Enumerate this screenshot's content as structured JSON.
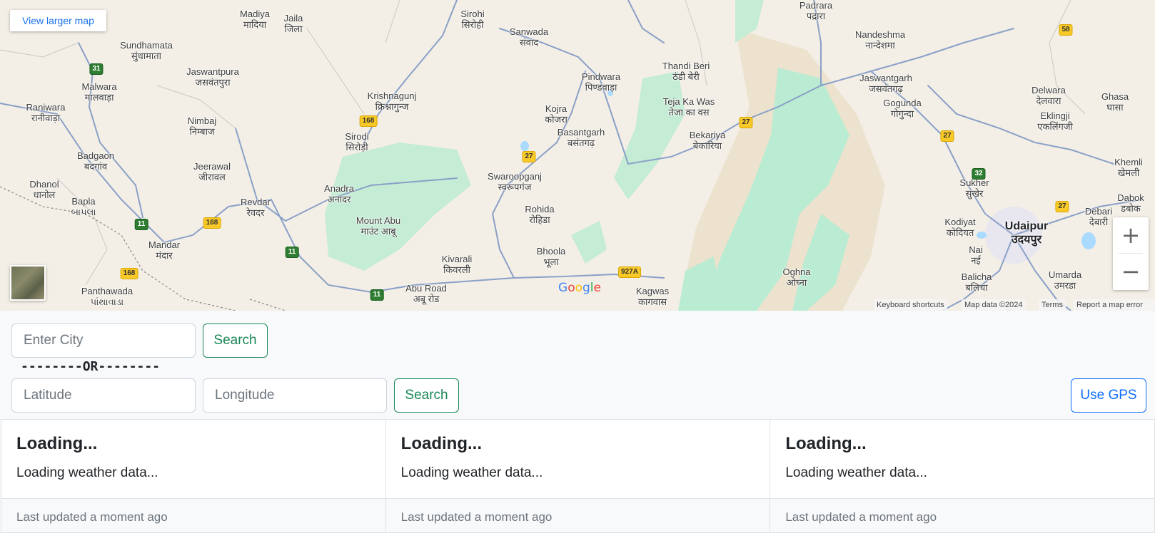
{
  "map": {
    "larger_map_label": "View larger map",
    "zoom_in": "+",
    "zoom_out": "−",
    "google_logo": [
      "G",
      "o",
      "o",
      "g",
      "l",
      "e"
    ],
    "google_colors": [
      "#4285F4",
      "#EA4335",
      "#FBBC05",
      "#4285F4",
      "#34A853",
      "#EA4335"
    ],
    "attribution": {
      "shortcuts": "Keyboard shortcuts",
      "map_data": "Map data ©2024",
      "terms": "Terms",
      "report": "Report a map error"
    },
    "places": [
      {
        "name": "Madiya",
        "local": "मादिया"
      },
      {
        "name": "Jaila",
        "local": "जिला"
      },
      {
        "name": "Sirohi",
        "local": "सिरोही"
      },
      {
        "name": "Sanwada",
        "local": "संवाद"
      },
      {
        "name": "Padrara",
        "local": "पद्रारा"
      },
      {
        "name": "Nandeshma",
        "local": "नान्देशमा"
      },
      {
        "name": "Sundhamata",
        "local": "सुंधामाता"
      },
      {
        "name": "Jaswantpura",
        "local": "जसवंतपुरा"
      },
      {
        "name": "Pindwara",
        "local": "पिण्डवाड़ा"
      },
      {
        "name": "Thandi Beri",
        "local": "ठंडी बेरी"
      },
      {
        "name": "Jaswantgarh",
        "local": "जसवंतगढ़"
      },
      {
        "name": "Malwara",
        "local": "मालवाड़ा"
      },
      {
        "name": "Krishnagunj",
        "local": "क्रिश्नागुन्ज"
      },
      {
        "name": "Teja Ka Was",
        "local": "तेजा का वस"
      },
      {
        "name": "Gogunda",
        "local": "गोगुन्दा"
      },
      {
        "name": "Delwara",
        "local": "देलवारा"
      },
      {
        "name": "Ghasa",
        "local": "घासा"
      },
      {
        "name": "Raniwara",
        "local": "रानीवाड़ा"
      },
      {
        "name": "Kojra",
        "local": "कोजरा"
      },
      {
        "name": "Eklingji",
        "local": "एकलिंगजी"
      },
      {
        "name": "Nimbaj",
        "local": "निम्बाज"
      },
      {
        "name": "Basantgarh",
        "local": "बसंतगढ़"
      },
      {
        "name": "Sirodi",
        "local": "सिरोड़ी"
      },
      {
        "name": "Bekariya",
        "local": "बेकारिया"
      },
      {
        "name": "Badgaon",
        "local": "बदगांव"
      },
      {
        "name": "Jeerawal",
        "local": "जीरावल"
      },
      {
        "name": "Khemli",
        "local": "खेमली"
      },
      {
        "name": "Swaroopganj",
        "local": "स्वरूपगंज"
      },
      {
        "name": "Dhanol",
        "local": "धानोल"
      },
      {
        "name": "Anadra",
        "local": "अनादर"
      },
      {
        "name": "Sukher",
        "local": "सुखेर"
      },
      {
        "name": "Dabok",
        "local": "डबोक"
      },
      {
        "name": "Bapla",
        "local": "બાપલા"
      },
      {
        "name": "Revdar",
        "local": "रेवदर"
      },
      {
        "name": "Rohida",
        "local": "रोहिडा"
      },
      {
        "name": "Debari",
        "local": "देबारी"
      },
      {
        "name": "Mount Abu",
        "local": "माउंट आबू"
      },
      {
        "name": "Kodiyat",
        "local": "कोदियत"
      },
      {
        "name": "Udaipur",
        "local": "उदयपुर"
      },
      {
        "name": "Mandar",
        "local": "मंदार"
      },
      {
        "name": "Bhoola",
        "local": "भूला"
      },
      {
        "name": "Nai",
        "local": "नई"
      },
      {
        "name": "Kivarali",
        "local": "किवरली"
      },
      {
        "name": "Oghna",
        "local": "ओघ्ना"
      },
      {
        "name": "Balicha",
        "local": "बलिचा"
      },
      {
        "name": "Umarda",
        "local": "उमरडा"
      },
      {
        "name": "Panthawada",
        "local": "પાંથાવાડા"
      },
      {
        "name": "Abu Road",
        "local": "अबू रोड"
      },
      {
        "name": "Kagwas",
        "local": "कागवास"
      }
    ],
    "shields": [
      {
        "label": "31",
        "kind": "nh"
      },
      {
        "label": "168",
        "kind": "state"
      },
      {
        "label": "27",
        "kind": "state"
      },
      {
        "label": "27",
        "kind": "state"
      },
      {
        "label": "58",
        "kind": "state"
      },
      {
        "label": "27",
        "kind": "state"
      },
      {
        "label": "32",
        "kind": "nh"
      },
      {
        "label": "27",
        "kind": "state"
      },
      {
        "label": "11",
        "kind": "nh"
      },
      {
        "label": "168",
        "kind": "state"
      },
      {
        "label": "11",
        "kind": "nh"
      },
      {
        "label": "168",
        "kind": "state"
      },
      {
        "label": "927A",
        "kind": "state"
      },
      {
        "label": "11",
        "kind": "nh"
      }
    ]
  },
  "city_search": {
    "placeholder": "Enter City",
    "button": "Search"
  },
  "separator": "--------OR--------",
  "coord_search": {
    "lat_placeholder": "Latitude",
    "lon_placeholder": "Longitude",
    "button": "Search",
    "gps_button": "Use GPS"
  },
  "colors": {
    "success": "#198754",
    "primary": "#0d6efd",
    "park_green": "#b9ecd2",
    "water": "#aadaff",
    "road": "#8aa0c8"
  },
  "cards": [
    {
      "title": "Loading...",
      "text": "Loading weather data...",
      "footer": "Last updated a moment ago"
    },
    {
      "title": "Loading...",
      "text": "Loading weather data...",
      "footer": "Last updated a moment ago"
    },
    {
      "title": "Loading...",
      "text": "Loading weather data...",
      "footer": "Last updated a moment ago"
    }
  ]
}
